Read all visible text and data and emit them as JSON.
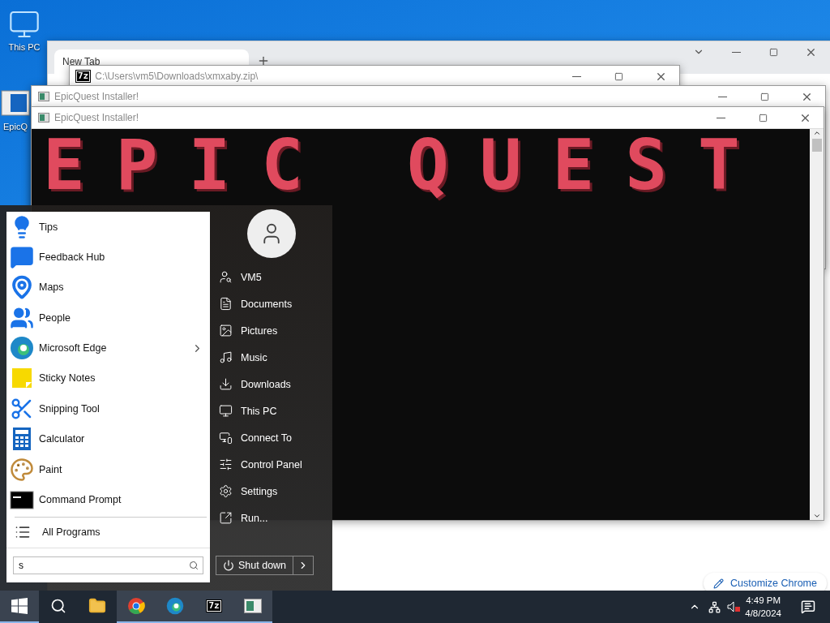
{
  "desktop_icons": [
    {
      "label": "This PC",
      "kind": "computer"
    },
    {
      "label": "EpicQ",
      "kind": "installer"
    }
  ],
  "browser_window": {
    "tab": {
      "title": "New Tab"
    },
    "customize_button": "Customize Chrome"
  },
  "archive_window": {
    "app_badge": "7z",
    "title": "C:\\Users\\vm5\\Downloads\\xmxaby.zip\\"
  },
  "installer_windows": [
    {
      "title": "EpicQuest Installer!"
    },
    {
      "title": "EpicQuest Installer!",
      "banner": "EPIC QUEST"
    }
  ],
  "start_menu": {
    "programs": [
      {
        "label": "Tips",
        "kind": "tips",
        "has_submenu": false
      },
      {
        "label": "Feedback Hub",
        "kind": "feedback",
        "has_submenu": false
      },
      {
        "label": "Maps",
        "kind": "maps",
        "has_submenu": false
      },
      {
        "label": "People",
        "kind": "people",
        "has_submenu": false
      },
      {
        "label": "Microsoft Edge",
        "kind": "edge",
        "has_submenu": true
      },
      {
        "label": "Sticky Notes",
        "kind": "notes",
        "has_submenu": false
      },
      {
        "label": "Snipping Tool",
        "kind": "snipping",
        "has_submenu": false
      },
      {
        "label": "Calculator",
        "kind": "calculator",
        "has_submenu": false
      },
      {
        "label": "Paint",
        "kind": "paint",
        "has_submenu": false
      },
      {
        "label": "Command Prompt",
        "kind": "terminal",
        "has_submenu": false
      }
    ],
    "all_programs": "All Programs",
    "search": {
      "value": "s"
    },
    "places": [
      {
        "label": "VM5",
        "kind": "user"
      },
      {
        "label": "Documents",
        "kind": "document"
      },
      {
        "label": "Pictures",
        "kind": "picture"
      },
      {
        "label": "Music",
        "kind": "music"
      },
      {
        "label": "Downloads",
        "kind": "download"
      },
      {
        "label": "This PC",
        "kind": "computer"
      },
      {
        "label": "Connect To",
        "kind": "connect"
      },
      {
        "label": "Control Panel",
        "kind": "control"
      },
      {
        "label": "Settings",
        "kind": "settings"
      },
      {
        "label": "Run...",
        "kind": "run"
      }
    ],
    "shutdown": "Shut down"
  },
  "taskbar": {
    "apps": [
      {
        "kind": "explorer",
        "active": false
      },
      {
        "kind": "chrome",
        "active": true
      },
      {
        "kind": "edge",
        "active": true
      },
      {
        "kind": "archiver",
        "badge": "7z",
        "active": true
      },
      {
        "kind": "installer",
        "active": true
      }
    ],
    "time": "4:49 PM",
    "date": "4/8/2024"
  }
}
